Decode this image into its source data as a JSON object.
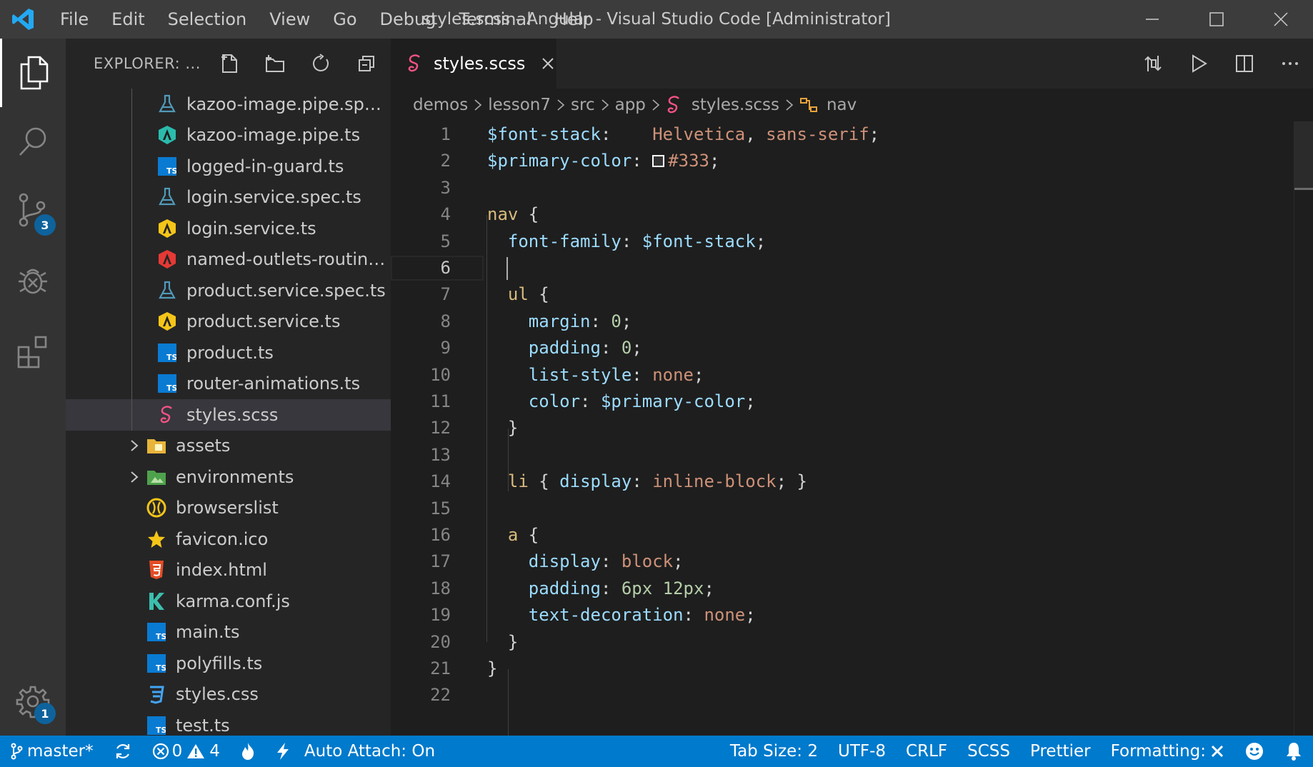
{
  "window": {
    "title": "styles.scss - Angular - Visual Studio Code [Administrator]",
    "menu": [
      "File",
      "Edit",
      "Selection",
      "View",
      "Go",
      "Debug",
      "Terminal",
      "Help"
    ]
  },
  "activity_bar": {
    "items": [
      "explorer-icon",
      "search-icon",
      "source-control-icon",
      "debug-icon",
      "extensions-icon"
    ],
    "source_control_badge": "3",
    "settings_badge": "1"
  },
  "sidebar": {
    "title": "EXPLORER: ...",
    "actions": [
      "new-file-icon",
      "new-folder-icon",
      "refresh-icon",
      "collapse-all-icon"
    ],
    "files": [
      {
        "label": "kazoo-image.pipe.spec...",
        "icon": "test-flask-icon",
        "level": 2
      },
      {
        "label": "kazoo-image.pipe.ts",
        "icon": "angular-pipe-icon",
        "level": 2
      },
      {
        "label": "logged-in-guard.ts",
        "icon": "typescript-icon",
        "level": 2
      },
      {
        "label": "login.service.spec.ts",
        "icon": "test-flask-icon",
        "level": 2
      },
      {
        "label": "login.service.ts",
        "icon": "angular-service-icon",
        "level": 2
      },
      {
        "label": "named-outlets-routing...",
        "icon": "angular-routing-icon",
        "level": 2
      },
      {
        "label": "product.service.spec.ts",
        "icon": "test-flask-icon",
        "level": 2
      },
      {
        "label": "product.service.ts",
        "icon": "angular-service-icon",
        "level": 2
      },
      {
        "label": "product.ts",
        "icon": "typescript-icon",
        "level": 2
      },
      {
        "label": "router-animations.ts",
        "icon": "typescript-icon",
        "level": 2
      },
      {
        "label": "styles.scss",
        "icon": "sass-icon",
        "level": 2,
        "selected": true
      },
      {
        "label": "assets",
        "icon": "folder-icon",
        "level": 1,
        "folder": true
      },
      {
        "label": "environments",
        "icon": "folder-env-icon",
        "level": 1,
        "folder": true
      },
      {
        "label": "browserslist",
        "icon": "browserslist-icon",
        "level": 1
      },
      {
        "label": "favicon.ico",
        "icon": "star-icon",
        "level": 1
      },
      {
        "label": "index.html",
        "icon": "html-icon",
        "level": 1
      },
      {
        "label": "karma.conf.js",
        "icon": "karma-icon",
        "level": 1
      },
      {
        "label": "main.ts",
        "icon": "typescript-icon",
        "level": 1
      },
      {
        "label": "polyfills.ts",
        "icon": "typescript-icon",
        "level": 1
      },
      {
        "label": "styles.css",
        "icon": "css-icon",
        "level": 1
      },
      {
        "label": "test.ts",
        "icon": "typescript-icon",
        "level": 1
      }
    ]
  },
  "tab": {
    "label": "styles.scss"
  },
  "breadcrumbs": [
    "demos",
    "lesson7",
    "src",
    "app",
    "styles.scss",
    "nav"
  ],
  "code": {
    "current_line": 6,
    "lines": [
      [
        [
          "t-var",
          "$font-stack"
        ],
        [
          "t-punc",
          ":    "
        ],
        [
          "t-str",
          "Helvetica"
        ],
        [
          "t-punc",
          ", "
        ],
        [
          "t-str",
          "sans-serif"
        ],
        [
          "t-punc",
          ";"
        ]
      ],
      [
        [
          "t-var",
          "$primary-color"
        ],
        [
          "t-punc",
          ": "
        ],
        [
          "swatch",
          ""
        ],
        [
          "t-str",
          "#333"
        ],
        [
          "t-punc",
          ";"
        ]
      ],
      [],
      [
        [
          "t-sel",
          "nav"
        ],
        [
          "t-punc",
          " {"
        ]
      ],
      [
        [
          "t-punc",
          "  "
        ],
        [
          "t-var",
          "font-family"
        ],
        [
          "t-punc",
          ": "
        ],
        [
          "t-var",
          "$font-stack"
        ],
        [
          "t-punc",
          ";"
        ]
      ],
      [],
      [
        [
          "t-punc",
          "  "
        ],
        [
          "t-sel",
          "ul"
        ],
        [
          "t-punc",
          " {"
        ]
      ],
      [
        [
          "t-punc",
          "    "
        ],
        [
          "t-var",
          "margin"
        ],
        [
          "t-punc",
          ": "
        ],
        [
          "t-num",
          "0"
        ],
        [
          "t-punc",
          ";"
        ]
      ],
      [
        [
          "t-punc",
          "    "
        ],
        [
          "t-var",
          "padding"
        ],
        [
          "t-punc",
          ": "
        ],
        [
          "t-num",
          "0"
        ],
        [
          "t-punc",
          ";"
        ]
      ],
      [
        [
          "t-punc",
          "    "
        ],
        [
          "t-var",
          "list-style"
        ],
        [
          "t-punc",
          ": "
        ],
        [
          "t-str",
          "none"
        ],
        [
          "t-punc",
          ";"
        ]
      ],
      [
        [
          "t-punc",
          "    "
        ],
        [
          "t-var",
          "color"
        ],
        [
          "t-punc",
          ": "
        ],
        [
          "t-var",
          "$primary-color"
        ],
        [
          "t-punc",
          ";"
        ]
      ],
      [
        [
          "t-punc",
          "  }"
        ]
      ],
      [],
      [
        [
          "t-punc",
          "  "
        ],
        [
          "t-sel",
          "li"
        ],
        [
          "t-punc",
          " { "
        ],
        [
          "t-var",
          "display"
        ],
        [
          "t-punc",
          ": "
        ],
        [
          "t-str",
          "inline-block"
        ],
        [
          "t-punc",
          "; }"
        ]
      ],
      [],
      [
        [
          "t-punc",
          "  "
        ],
        [
          "t-sel",
          "a"
        ],
        [
          "t-punc",
          " {"
        ]
      ],
      [
        [
          "t-punc",
          "    "
        ],
        [
          "t-var",
          "display"
        ],
        [
          "t-punc",
          ": "
        ],
        [
          "t-str",
          "block"
        ],
        [
          "t-punc",
          ";"
        ]
      ],
      [
        [
          "t-punc",
          "    "
        ],
        [
          "t-var",
          "padding"
        ],
        [
          "t-punc",
          ": "
        ],
        [
          "t-num",
          "6px 12px"
        ],
        [
          "t-punc",
          ";"
        ]
      ],
      [
        [
          "t-punc",
          "    "
        ],
        [
          "t-var",
          "text-decoration"
        ],
        [
          "t-punc",
          ": "
        ],
        [
          "t-str",
          "none"
        ],
        [
          "t-punc",
          ";"
        ]
      ],
      [
        [
          "t-punc",
          "  }"
        ]
      ],
      [
        [
          "t-punc",
          "}"
        ]
      ],
      []
    ]
  },
  "status": {
    "branch": "master*",
    "errors": "0",
    "warnings": "4",
    "auto_attach": "Auto Attach: On",
    "tab_size": "Tab Size: 2",
    "encoding": "UTF-8",
    "eol": "CRLF",
    "language": "SCSS",
    "formatter": "Prettier",
    "formatting": "Formatting:"
  }
}
